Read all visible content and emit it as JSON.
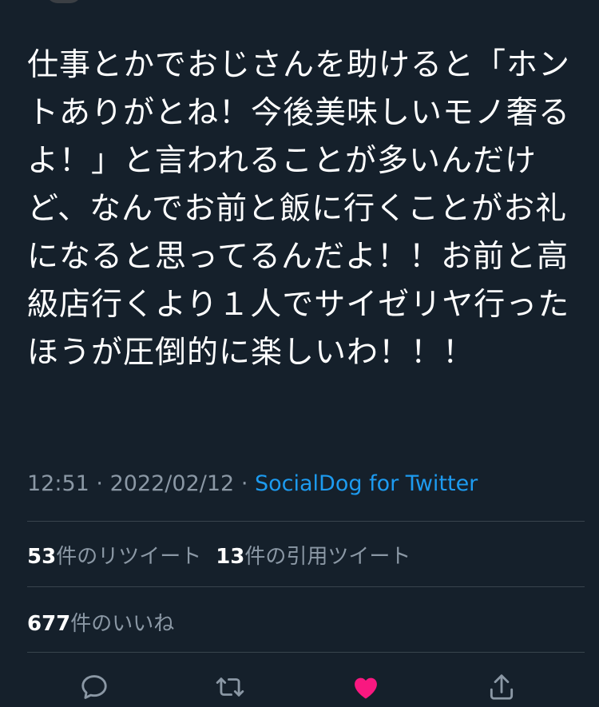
{
  "tweet": {
    "text": "仕事とかでおじさんを助けると「ホントありがとね！今後美味しいモノ奢るよ！」と言われることが多いんだけど、なんでお前と飯に行くことがお礼になると思ってるんだよ！！お前と高級店行くより１人でサイゼリヤ行ったほうが圧倒的に楽しいわ！！！",
    "time": "12:51",
    "date": "2022/02/12",
    "separator": "·",
    "source": "SocialDog for Twitter"
  },
  "stats": {
    "retweets": {
      "count": "53",
      "label": "件のリツイート"
    },
    "quotes": {
      "count": "13",
      "label": "件の引用ツイート"
    },
    "likes": {
      "count": "677",
      "label": "件のいいね"
    }
  },
  "actions": {
    "reply": "reply-icon",
    "retweet": "retweet-icon",
    "like": "heart-icon",
    "share": "share-icon",
    "like_color": "#f91880",
    "icon_color": "#8b98a5"
  }
}
